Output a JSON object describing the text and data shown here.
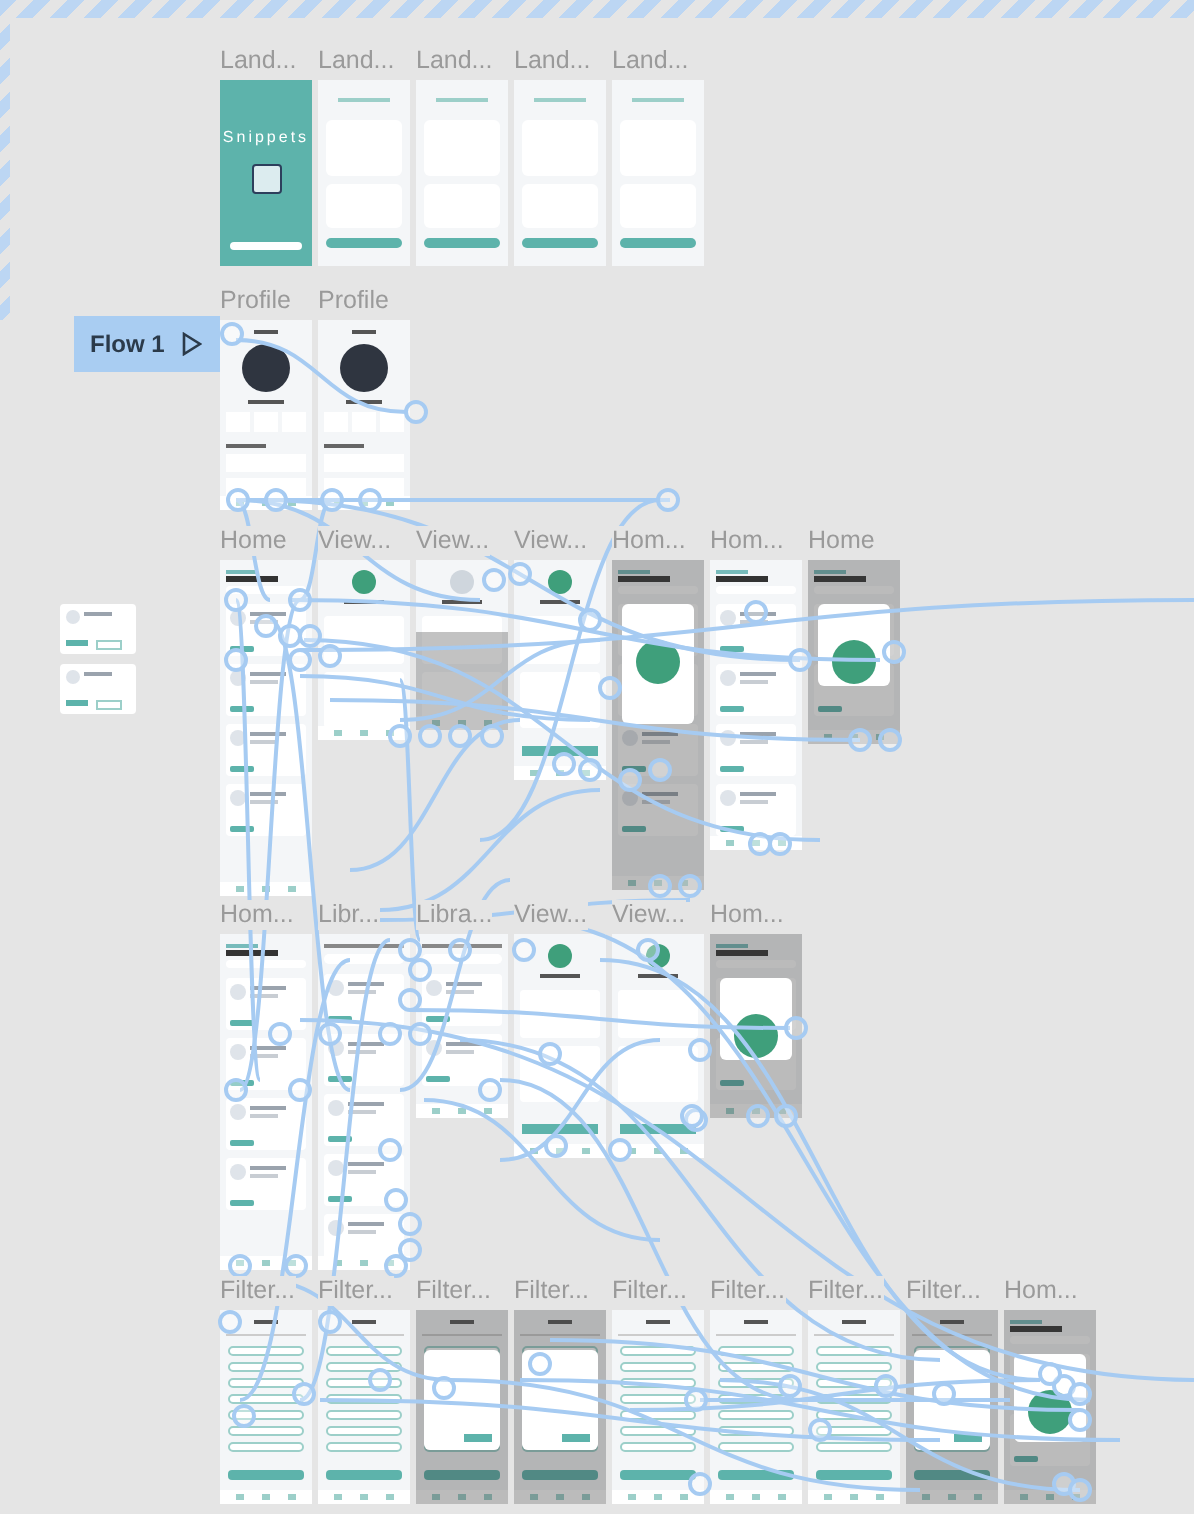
{
  "flow_start": {
    "label": "Flow 1"
  },
  "rows": [
    {
      "frames": [
        {
          "title": "Land...",
          "kind": "splash",
          "heading": "Snippets"
        },
        {
          "title": "Land...",
          "kind": "onboard"
        },
        {
          "title": "Land...",
          "kind": "onboard"
        },
        {
          "title": "Land...",
          "kind": "onboard"
        },
        {
          "title": "Land...",
          "kind": "onboard"
        }
      ]
    },
    {
      "frames": [
        {
          "title": "Profile",
          "kind": "profile"
        },
        {
          "title": "Profile",
          "kind": "profile"
        }
      ]
    },
    {
      "frames": [
        {
          "title": "Home",
          "kind": "home"
        },
        {
          "title": "View...",
          "kind": "detail"
        },
        {
          "title": "View...",
          "kind": "detail-dim"
        },
        {
          "title": "View...",
          "kind": "detail"
        },
        {
          "title": "Hom...",
          "kind": "home-modal"
        },
        {
          "title": "Hom...",
          "kind": "home"
        },
        {
          "title": "Home",
          "kind": "home-modal"
        }
      ]
    },
    {
      "frames": [
        {
          "title": "Hom...",
          "kind": "home"
        },
        {
          "title": "Libr...",
          "kind": "library"
        },
        {
          "title": "Libra...",
          "kind": "library"
        },
        {
          "title": "View...",
          "kind": "detail"
        },
        {
          "title": "View...",
          "kind": "detail"
        },
        {
          "title": "Hom...",
          "kind": "home-modal"
        }
      ]
    },
    {
      "frames": [
        {
          "title": "Filter...",
          "kind": "filter"
        },
        {
          "title": "Filter...",
          "kind": "filter"
        },
        {
          "title": "Filter...",
          "kind": "filter-modal"
        },
        {
          "title": "Filter...",
          "kind": "filter-modal"
        },
        {
          "title": "Filter...",
          "kind": "filter"
        },
        {
          "title": "Filter...",
          "kind": "filter"
        },
        {
          "title": "Filter...",
          "kind": "filter"
        },
        {
          "title": "Filter...",
          "kind": "filter-modal"
        },
        {
          "title": "Hom...",
          "kind": "home-modal"
        }
      ]
    }
  ]
}
